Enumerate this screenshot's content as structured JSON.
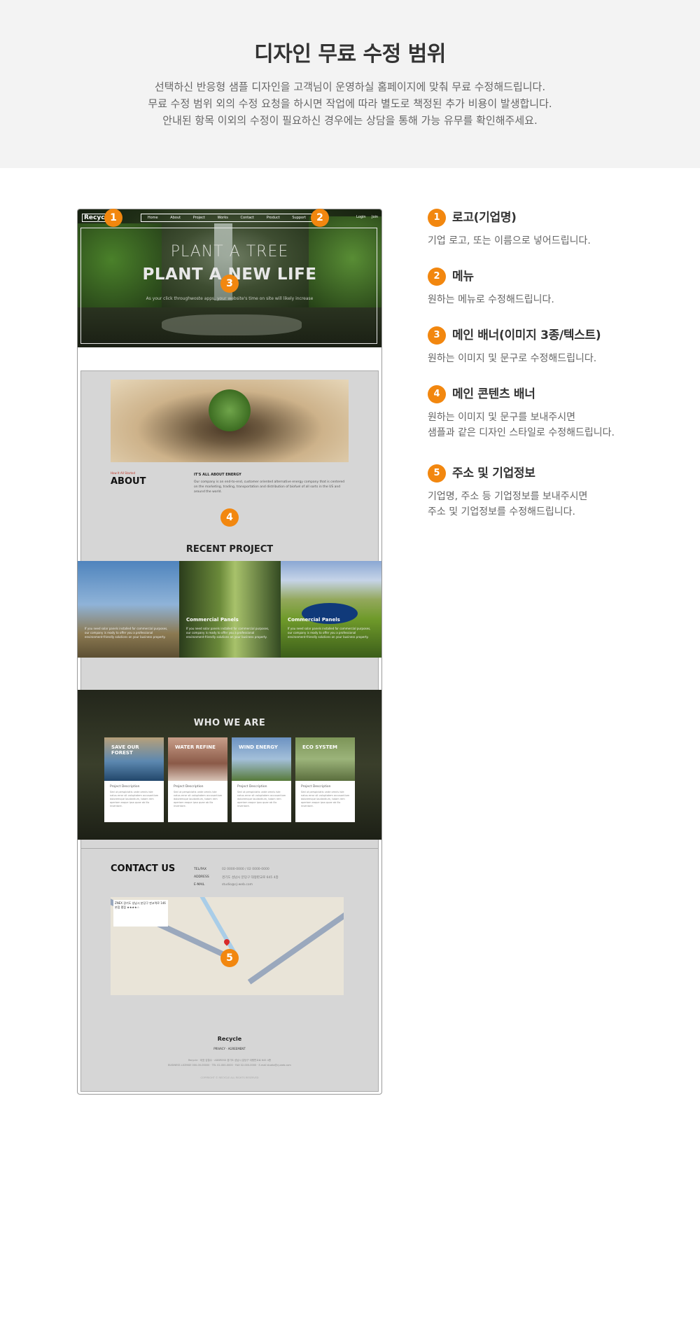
{
  "header": {
    "title": "디자인 무료 수정 범위",
    "lines": [
      "선택하신 반응형 샘플 디자인을 고객님이 운영하실 홈페이지에 맞춰 무료 수정해드립니다.",
      "무료 수정 범위 외의 수정 요청을 하시면 작업에 따라 별도로 책정된 추가 비용이 발생합니다.",
      "안내된 항목 이외의 수정이 필요하신 경우에는 상담을 통해 가능 유무를 확인해주세요."
    ]
  },
  "preview": {
    "logo": "Recycle",
    "nav": [
      "Home",
      "About",
      "Project",
      "Works",
      "Contact",
      "Product",
      "Support"
    ],
    "login": "Login",
    "join": "Join",
    "hero_line1": "PLANT A TREE",
    "hero_line2": "PLANT A NEW LIFE",
    "hero_sub": "As your click throughwoste apps, your website's time on site will likely increase",
    "about_tag": "How It All Started",
    "about_title": "ABOUT",
    "about_heading": "IT'S ALL ABOUT ENERGY",
    "about_text": "Our company is an end-to-end, customer oriented alternative energy company that is centered on the marketing, trading, transportation and distribution of biofuel of all sorts in the US and around the world.",
    "recent_title": "RECENT PROJECT",
    "projects": [
      {
        "title": "",
        "text": "If you need solar panels installed for commercial purposes, our company is ready to offer you a professional environment-friendly solutions on your business property."
      },
      {
        "title": "Commercial Panels",
        "text": "If you need solar panels installed for commercial purposes, our company is ready to offer you a professional environment-friendly solutions on your business property."
      },
      {
        "title": "Commercial Panels",
        "text": "If you need solar panels installed for commercial purposes, our company is ready to offer you a professional environment-friendly solutions on your business property."
      }
    ],
    "who_title": "WHO WE ARE",
    "cards": [
      {
        "title": "SAVE OUR FOREST",
        "desc": "Project Description",
        "text": "Sed ut perspiciatis unde omnis iste natus error sit voluptatem accusantium doloremque laudantium, totam rem aperiam eaque ipsa quae ab illo inventore."
      },
      {
        "title": "WATER REFINE",
        "desc": "Project Description",
        "text": "Sed ut perspiciatis unde omnis iste natus error sit voluptatem accusantium doloremque laudantium, totam rem aperiam eaque ipsa quae ab illo inventore."
      },
      {
        "title": "WIND ENERGY",
        "desc": "Project Description",
        "text": "Sed ut perspiciatis unde omnis iste natus error sit voluptatem accusantium doloremque laudantium, totam rem aperiam eaque ipsa quae ab illo inventore."
      },
      {
        "title": "ECO SYSTEM",
        "desc": "Project Description",
        "text": "Sed ut perspiciatis unde omnis iste natus error sit voluptatem accusantium doloremque laudantium, totam rem aperiam eaque ipsa quae ab illo inventore."
      }
    ],
    "contact_title": "CONTACT US",
    "contact_rows": [
      {
        "label": "TEL/FAX",
        "value": "02 0000-0000 / 02 0000-0000"
      },
      {
        "label": "ADDRESS",
        "value": "경기도 성남시 분당구 대왕판교로 645 4층"
      },
      {
        "label": "E-MAIL",
        "value": "studio@cj-web.com"
      }
    ],
    "map_info": "ZNEX 경기도 성남시 분당구 판교역로 146 본점 평점 ★★★★☆",
    "footer_brand": "Recycle",
    "footer_links": "PRIVACY  ·  AGREEMENT",
    "footer_info1": "Recycle   ·   대표 김철수   ·   ADDRESS 경기도 성남시 분당구 대왕판교로 645 4층",
    "footer_info2": "BUSINESS LICENSE 000-00-00000   ·   TEL 02-000-0000   ·   FAX 02-000-0000   ·   E-mail studio@cj-web.com",
    "footer_copy": "COPYRIGHT © RECYCLE ALL RIGHTS RESERVED"
  },
  "markers": [
    "1",
    "2",
    "3",
    "4",
    "5"
  ],
  "items": [
    {
      "num": "1",
      "title": "로고(기업명)",
      "lines": [
        "기업 로고, 또는 이름으로 넣어드립니다."
      ]
    },
    {
      "num": "2",
      "title": "메뉴",
      "lines": [
        "원하는 메뉴로 수정해드립니다."
      ]
    },
    {
      "num": "3",
      "title": "메인 배너(이미지 3종/텍스트)",
      "lines": [
        "원하는 이미지 및 문구로 수정해드립니다."
      ]
    },
    {
      "num": "4",
      "title": "메인 콘텐츠 배너",
      "lines": [
        "원하는 이미지 및 문구를 보내주시면",
        "샘플과 같은 디자인 스타일로 수정해드립니다."
      ]
    },
    {
      "num": "5",
      "title": "주소 및 기업정보",
      "lines": [
        "기업명, 주소 등 기업정보를 보내주시면",
        "주소 및 기업정보를 수정해드립니다."
      ]
    }
  ],
  "colors": {
    "accent": "#f2870f",
    "band": "#f3f3f3"
  }
}
